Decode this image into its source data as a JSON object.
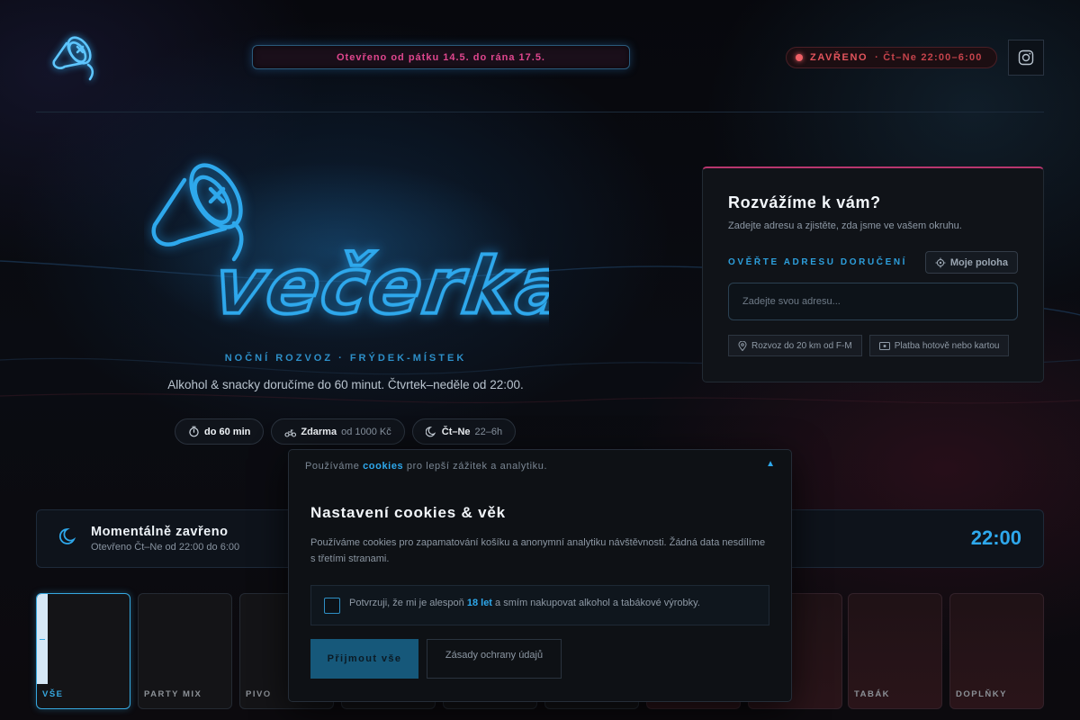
{
  "header": {
    "announcement": "Otevřeno od pátku 14.5. do rána 17.5.",
    "status": {
      "label": "ZAVŘENO",
      "hours": "· Čt–Ne 22:00–6:00",
      "color": "#e2545c"
    },
    "instagram_icon": "instagram-icon",
    "logo_icon": "megaphone-neon-icon"
  },
  "hero": {
    "brand_logo_text": "večerka",
    "tagline": "NOČNÍ ROZVOZ · FRÝDEK-MÍSTEK",
    "description": "Alkohol & snacky doručíme do 60 minut. Čtvrtek–neděle od 22:00.",
    "chips": [
      {
        "icon": "timer-icon",
        "strong": "do 60 min",
        "muted": ""
      },
      {
        "icon": "scooter-icon",
        "strong": "Zdarma",
        "muted": "od 1000 Kč"
      },
      {
        "icon": "moon-icon",
        "strong": "Čt–Ne",
        "muted": "22–6h"
      }
    ]
  },
  "delivery": {
    "title": "Rozvážíme k vám?",
    "subtitle": "Zadejte adresu a zjistěte, zda jsme ve vašem okruhu.",
    "verify_label": "OVĚŘTE ADRESU DORUČENÍ",
    "location_button": "Moje poloha",
    "address_placeholder": "Zadejte svou adresu...",
    "tags": [
      {
        "icon": "pin-icon",
        "label": "Rozvoz do 20 km od F-M"
      },
      {
        "icon": "cash-icon",
        "label": "Platba hotově nebo kartou"
      }
    ]
  },
  "status_bar": {
    "title": "Momentálně zavřeno",
    "subtitle": "Otevřeno Čt–Ne od 22:00 do 6:00",
    "time": "22:00"
  },
  "categories": [
    {
      "label": "VŠE",
      "active": true
    },
    {
      "label": "PARTY MIX",
      "active": false
    },
    {
      "label": "PIVO",
      "active": false
    },
    {
      "label": "",
      "active": false
    },
    {
      "label": "",
      "active": false
    },
    {
      "label": "",
      "active": false
    },
    {
      "label": "",
      "active": false
    },
    {
      "label": "",
      "active": false
    },
    {
      "label": "TABÁK",
      "active": false
    },
    {
      "label": "DOPLŇKY",
      "active": false
    }
  ],
  "cookie": {
    "top_prefix": "Používáme",
    "top_highlight": "cookies",
    "top_suffix": "pro lepší zážitek a analytiku.",
    "toggle": "▲",
    "title": "Nastavení cookies & věk",
    "description": "Používáme cookies pro zapamatování košíku a anonymní analytiku návštěvnosti. Žádná data nesdílíme s třetími stranami.",
    "age_prefix": "Potvrzuji, že mi je alespoň",
    "age_highlight": "18 let",
    "age_suffix": "a smím nakupovat alkohol a tabákové výrobky.",
    "accept_label": "Přijmout vše",
    "privacy_label": "Zásady ochrany údajů"
  },
  "colors": {
    "accent_blue": "#2ea8ec",
    "accent_pink": "#e0468e",
    "closed_red": "#e2545c"
  }
}
